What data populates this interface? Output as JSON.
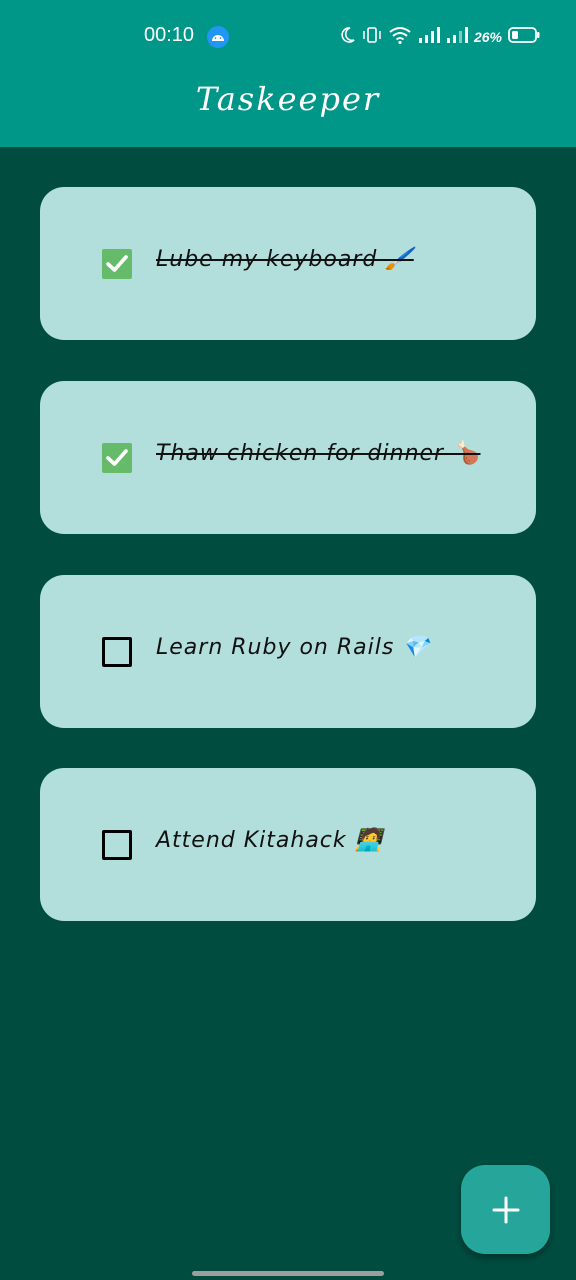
{
  "status_bar": {
    "time": "00:10",
    "battery": "26%"
  },
  "app": {
    "title": "Taskeeper"
  },
  "tasks": [
    {
      "label": "Lube my keyboard 🖌️",
      "done": true
    },
    {
      "label": "Thaw chicken for dinner 🍗",
      "done": true
    },
    {
      "label": "Learn Ruby on Rails 💎",
      "done": false
    },
    {
      "label": "Attend Kitahack 🧑‍💻",
      "done": false
    }
  ],
  "fab": {
    "icon": "plus-icon"
  },
  "colors": {
    "primary": "#009688",
    "background": "#004d40",
    "card": "#b2dfdb",
    "check": "#66bb6a",
    "fab": "#26a69a"
  }
}
